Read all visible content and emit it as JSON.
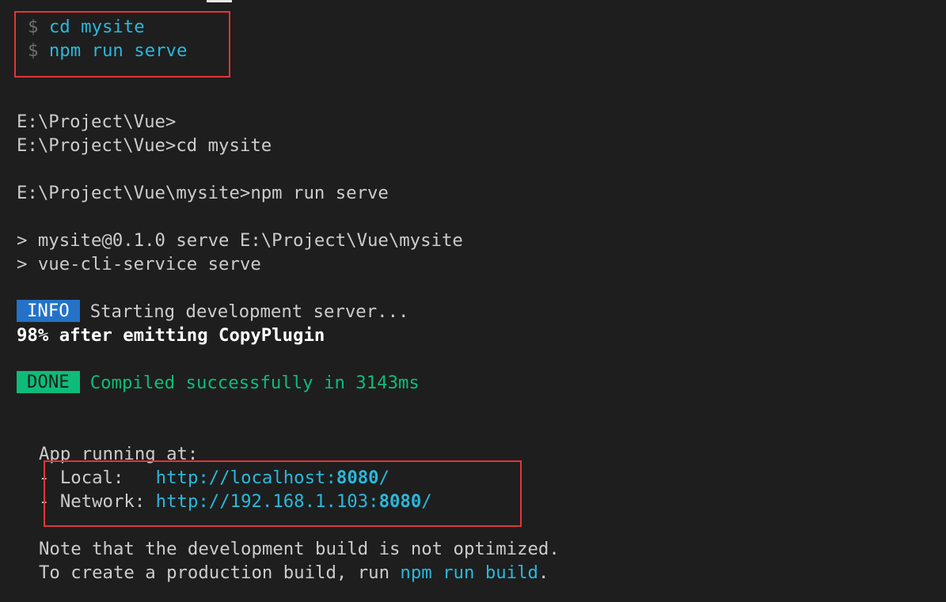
{
  "highlighted_commands": {
    "prompt_symbol": "$",
    "lines": [
      "cd mysite",
      "npm run serve"
    ]
  },
  "terminal": {
    "prompt1": "E:\\Project\\Vue>",
    "prompt2": "E:\\Project\\Vue>cd mysite",
    "prompt3": "E:\\Project\\Vue\\mysite>npm run serve",
    "script1": "> mysite@0.1.0 serve E:\\Project\\Vue\\mysite",
    "script2": "> vue-cli-service serve",
    "info_badge": "INFO",
    "info_text": "Starting development server...",
    "progress": "98% after emitting CopyPlugin",
    "done_badge": "DONE",
    "done_text": "Compiled successfully in 3143ms",
    "app_running": "App running at:",
    "local_label": "- Local:   ",
    "local_url": "http://localhost:",
    "local_port": "8080",
    "local_slash": "/",
    "network_label": "- Network: ",
    "network_url": "http://192.168.1.103:",
    "network_port": "8080",
    "network_slash": "/",
    "note1": "Note that the development build is not optimized.",
    "note2_prefix": "To create a production build, run ",
    "note2_cmd": "npm run build",
    "note2_suffix": "."
  },
  "colors": {
    "background": "#1e1e1e",
    "text": "#cccccc",
    "cyan": "#29b8db",
    "info_badge": "#2472c8",
    "done_badge": "#0dbc79",
    "highlight_box": "#e0363a"
  }
}
